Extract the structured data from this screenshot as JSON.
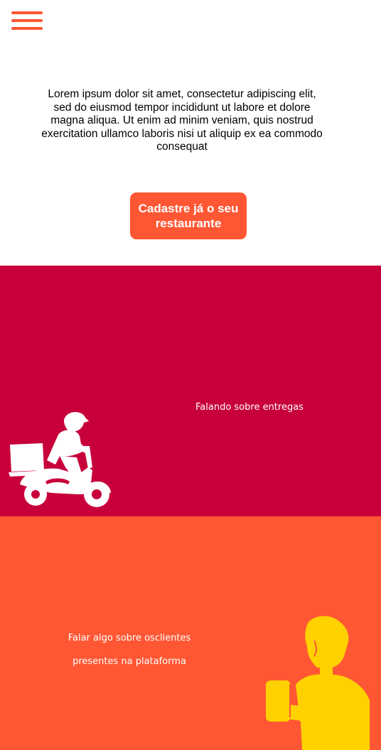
{
  "header": {
    "menu_icon": "hamburger-menu-icon"
  },
  "intro": {
    "text": "Lorem ipsum dolor sit amet, consectetur adipiscing elit, sed do eiusmod tempor incididunt ut labore et dolore magna aliqua. Ut enim ad minim veniam, quis nostrud exercitation ullamco laboris nisi ut aliquip ex ea commodo consequat"
  },
  "cta": {
    "label": "Cadastre já o seu restaurante"
  },
  "deliveries": {
    "label": "Falando sobre entregas",
    "icon": "delivery-scooter-icon"
  },
  "clients": {
    "label": "Falar algo sobre osclientes presentes na plataforma",
    "icon": "person-with-phone-icon"
  },
  "colors": {
    "accent": "#ff5733",
    "button_bg": "#ff5733",
    "button_text": "#ffffff",
    "deliveries_bg": "#c7003b",
    "clients_bg": "#ff5733",
    "clients_figure": "#ffd100"
  }
}
